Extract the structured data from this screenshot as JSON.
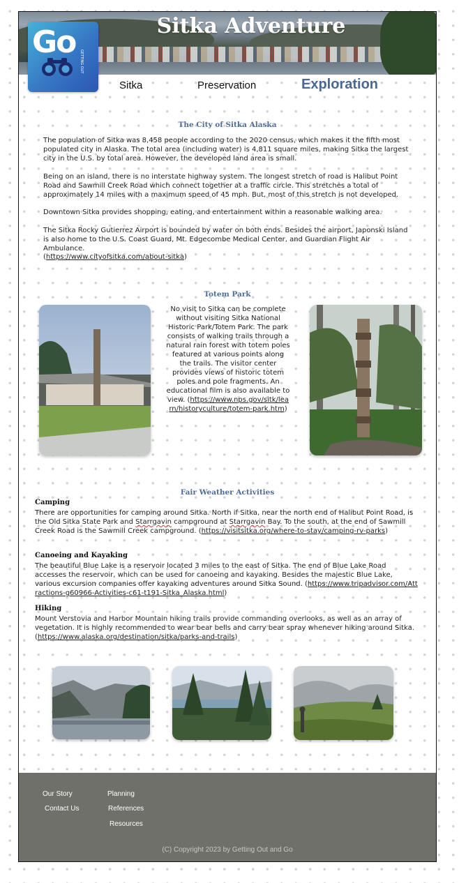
{
  "header": {
    "site_title": "Sitka Adventure",
    "logo_text": "Go",
    "logo_subtext": "GETTING OUT"
  },
  "nav": {
    "items": [
      "Sitka",
      "Preservation",
      "Exploration"
    ],
    "active": "Exploration"
  },
  "city_section": {
    "title": "The City of Sitka Alaska",
    "paragraphs": [
      "The population of Sitka was 8,458 people according to the 2020 census, which makes it the fifth most populated city in Alaska. The total area (including water) is 4,811 square miles, making Sitka the largest city in the U.S. by total area. However, the developed land area is small.",
      "Being on an island, there is no interstate highway system. The longest stretch of road is Halibut Point Road and Sawmill Creek Road which connect together at a traffic circle. This stretches a total of approximately 14 miles with a maximum speed of 45 mph. But, most of this stretch is not developed.",
      "Downtown Sitka provides shopping, eating, and entertainment within a reasonable walking area.",
      "The Sitka Rocky Gutierrez Airport is bounded by water on both ends. Besides the airport, Japonski Island is also home to the U.S. Coast Guard, Mt. Edgecombe Medical Center, and Guardian Flight Air Ambulance."
    ],
    "link": "https://www.cityofsitka.com/about-sitka"
  },
  "totem_section": {
    "title": "Totem Park",
    "text": "No visit to Sitka can be complete without visiting Sitka National Historic Park/Totem Park. The park consists of walking trails through a natural rain forest with totem poles featured at various points along the trails. The visitor center provides views of historic totem poles and pole fragments. An educational film is also available to view.",
    "link": "https://www.nps.gov/sitk/learn/historyculture/totem-park.htm"
  },
  "activities_section": {
    "title": "Fair Weather Activities",
    "items": [
      {
        "heading": "Camping",
        "text_a": "There are opportunities for camping around Sitka. North if Sitka, near the north end of Halibut Point Road, is the Old Sitka State Park and ",
        "text_b": "Starrgavin",
        "text_c": " campground at ",
        "text_d": "Starrgavin",
        "text_e": " Bay. To the south, at the end of Sawmill Creek Road is the Sawmill Creek campground. (",
        "link": "https://visitsitka.org/where-to-stay/camping-rv-parks",
        "close": ")"
      },
      {
        "heading": "Canoeing and Kayaking",
        "text": "The beautiful Blue Lake is a reservoir located 3 miles to the east of Sitka. The end of Blue Lake Road accesses the reservoir, which can be used for canoeing and kayaking. Besides the majestic Blue Lake, various excursion companies offer kayaking adventures around Sitka Sound. (",
        "link": "https://www.tripadvisor.com/Attractions-g60966-Activities-c61-t191-Sitka_Alaska.html",
        "close": ")"
      },
      {
        "heading": "Hiking",
        "text": "Mount Verstovia and Harbor Mountain hiking trails provide commanding overlooks, as well as an array of vegetation. It is highly recommended to wear bear bells and carry bear spray whenever hiking around Sitka. (",
        "link": "https://www.alaska.org/destination/sitka/parks-and-trails",
        "close": ")"
      }
    ]
  },
  "footer": {
    "links": [
      "Our Story",
      "Planning",
      "Contact Us",
      "References",
      "Resources"
    ],
    "copyright": "(C) Copyright  2023 by Getting Out and Go"
  }
}
